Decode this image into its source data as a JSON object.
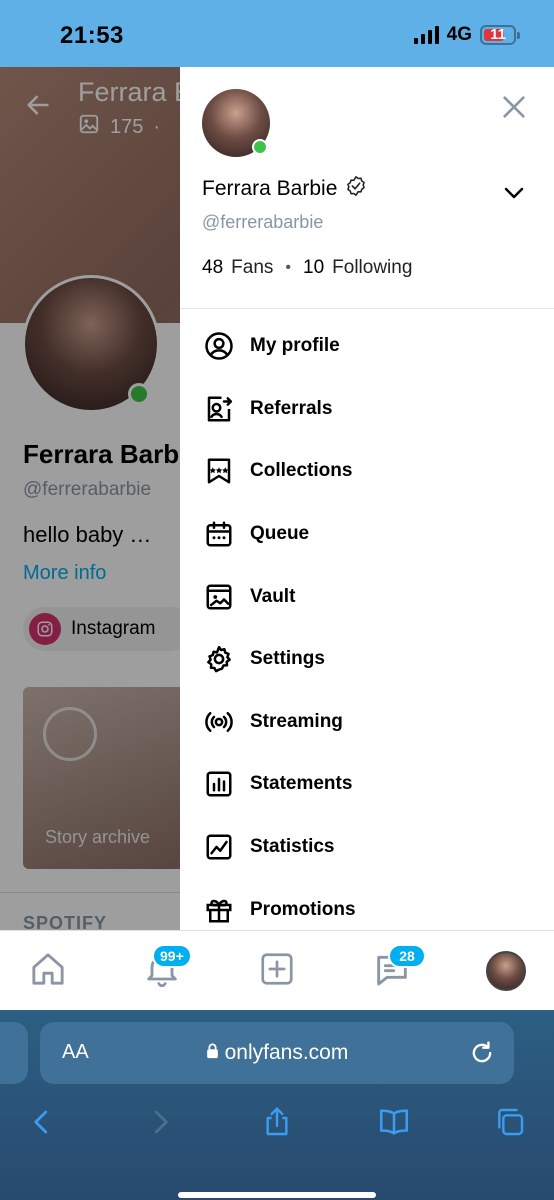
{
  "status_bar": {
    "time": "21:53",
    "network": "4G",
    "battery": "11",
    "battery_color": "#e0363b"
  },
  "background_profile": {
    "header_name": "Ferrara B",
    "header_stat": "175",
    "name": "Ferrara Barbi",
    "handle": "@ferrerabarbie",
    "bio": "hello baby …",
    "more_info": "More info",
    "social_chip": "Instagram",
    "story_label": "Story archive",
    "section_title": "SPOTIFY"
  },
  "drawer": {
    "name": "Ferrara Barbie",
    "handle": "@ferrerabarbie",
    "fans_count": "48",
    "fans_label": "Fans",
    "following_count": "10",
    "following_label": "Following",
    "menu": [
      {
        "label": "My profile",
        "icon": "user-circle-icon"
      },
      {
        "label": "Referrals",
        "icon": "referrals-icon"
      },
      {
        "label": "Collections",
        "icon": "collections-icon"
      },
      {
        "label": "Queue",
        "icon": "calendar-icon"
      },
      {
        "label": "Vault",
        "icon": "vault-icon"
      },
      {
        "label": "Settings",
        "icon": "gear-icon"
      },
      {
        "label": "Streaming",
        "icon": "broadcast-icon"
      },
      {
        "label": "Statements",
        "icon": "bar-chart-icon"
      },
      {
        "label": "Statistics",
        "icon": "trend-chart-icon"
      },
      {
        "label": "Promotions",
        "icon": "gift-icon"
      }
    ]
  },
  "tab_bar": {
    "notifications_badge": "99+",
    "messages_badge": "28",
    "accent": "#00aff0"
  },
  "safari": {
    "aa_label": "AA",
    "url": "onlyfans.com"
  }
}
